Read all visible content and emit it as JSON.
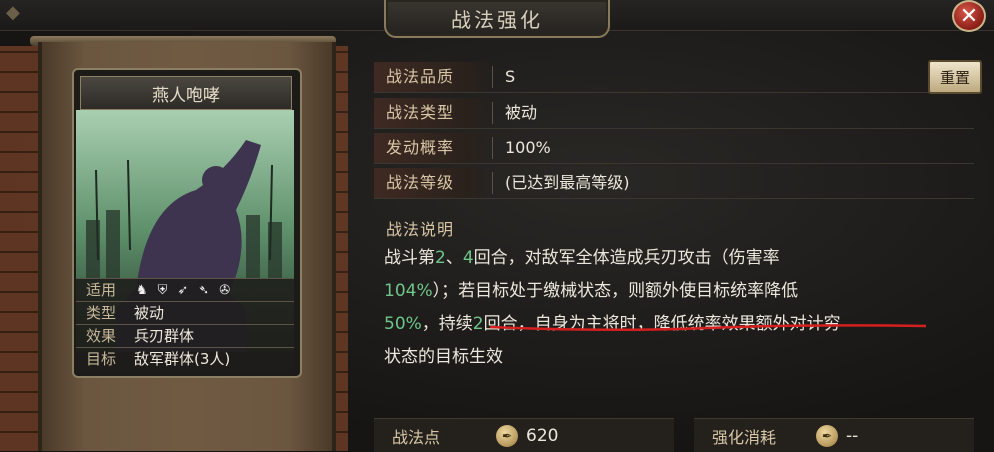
{
  "window": {
    "title": "战法强化",
    "close_icon": "close-icon"
  },
  "card": {
    "name": "燕人咆哮",
    "attrs": [
      {
        "key": "适用",
        "value": ""
      },
      {
        "key": "类型",
        "value": "被动"
      },
      {
        "key": "效果",
        "value": "兵刃群体"
      },
      {
        "key": "目标",
        "value": "敌军群体(3人)"
      }
    ],
    "applicable_icons": [
      "cavalry-icon",
      "shield-icon",
      "bow-icon",
      "spear-icon",
      "wheel-icon"
    ]
  },
  "info": {
    "quality_label": "战法品质",
    "quality_value": "S",
    "type_label": "战法类型",
    "type_value": "被动",
    "rate_label": "发动概率",
    "rate_value": "100%",
    "level_label": "战法等级",
    "level_value": "(已达到最高等级)",
    "reset_label": "重置"
  },
  "description": {
    "heading": "战法说明",
    "line1_a": "战斗第",
    "line1_n1": "2",
    "line1_sep": "、",
    "line1_n2": "4",
    "line1_b": "回合，对敌军全体造成兵刃攻击（伤害率",
    "line2_pct": "104%",
    "line2_a": "）；若目标处于缴械状态，则额外使目标统率降低",
    "line3_pct": "50%",
    "line3_a": "，持续",
    "line3_n": "2",
    "line3_b": "回合，自身为主将时，降低统率效果额外对计穷",
    "line4": "状态的目标生效"
  },
  "footer": {
    "points_label": "战法点",
    "points_value": "620",
    "cost_label": "强化消耗",
    "cost_value": "--"
  },
  "colors": {
    "highlight": "#6fc68a",
    "underline": "#d61f1f"
  }
}
